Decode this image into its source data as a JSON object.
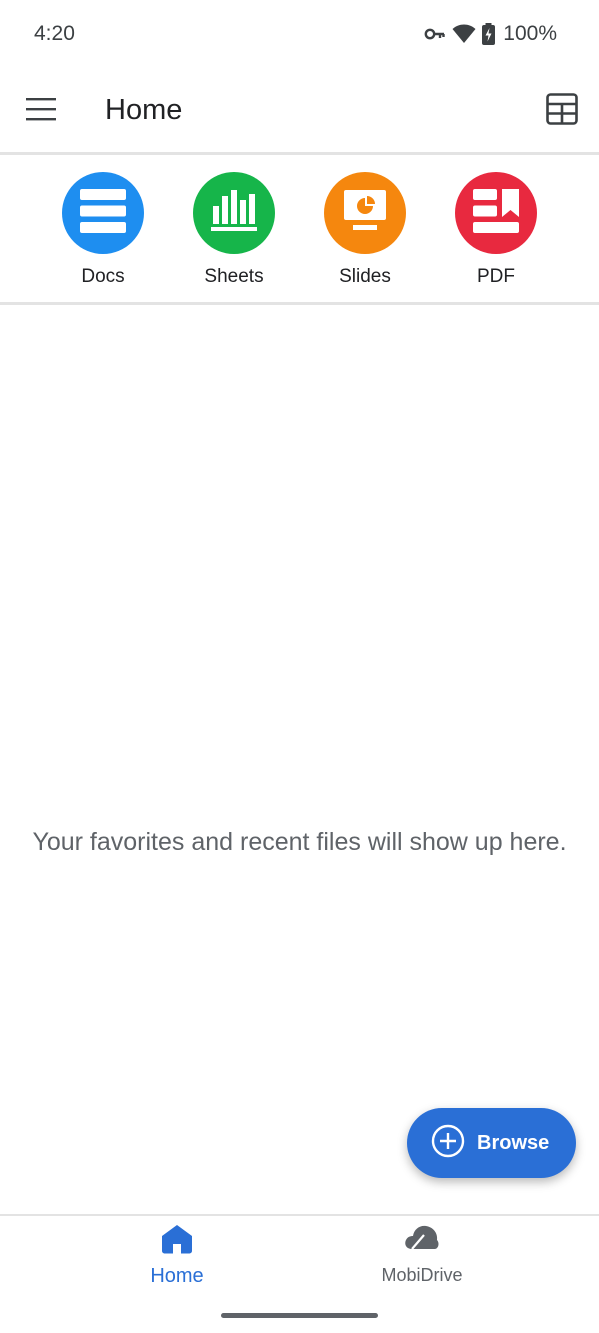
{
  "status_bar": {
    "time": "4:20",
    "battery": "100%",
    "icons": [
      "vpn-key-icon",
      "wifi-icon",
      "battery-charging-icon"
    ]
  },
  "app_bar": {
    "title": "Home",
    "left_icon": "hamburger-menu-icon",
    "right_icon": "grid-view-icon"
  },
  "quick_create": [
    {
      "label": "Docs",
      "color": "#1e8ef0",
      "icon": "docs-icon"
    },
    {
      "label": "Sheets",
      "color": "#16b54a",
      "icon": "sheets-icon"
    },
    {
      "label": "Slides",
      "color": "#f5870e",
      "icon": "slides-icon"
    },
    {
      "label": "PDF",
      "color": "#e8293f",
      "icon": "pdf-icon"
    }
  ],
  "empty_state": {
    "message": "Your favorites and recent files will show up here."
  },
  "fab": {
    "label": "Browse",
    "icon": "plus-circle-icon",
    "color": "#2a6fd6"
  },
  "bottom_nav": {
    "items": [
      {
        "label": "Home",
        "icon": "home-icon",
        "active": true
      },
      {
        "label": "MobiDrive",
        "icon": "cloud-icon",
        "active": false
      }
    ]
  }
}
